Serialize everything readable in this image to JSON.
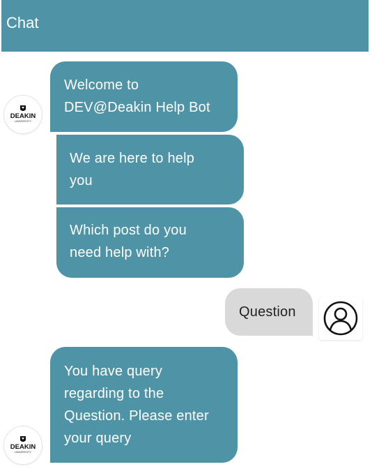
{
  "header": {
    "title": "Chat",
    "color": "#4f93a6"
  },
  "messages": [
    {
      "sender": "bot",
      "lines": [
        "Welcome to",
        "DEV@Deakin Help Bot"
      ]
    },
    {
      "sender": "bot",
      "lines": [
        "We are here to help",
        "you"
      ]
    },
    {
      "sender": "bot",
      "lines": [
        "Which post do you",
        "need help with?"
      ]
    },
    {
      "sender": "user",
      "lines": [
        "Question"
      ]
    },
    {
      "sender": "bot",
      "lines": [
        "You have query",
        "regarding to the",
        "Question. Please enter",
        "your query"
      ]
    }
  ],
  "bot_avatar": {
    "icon": "deakin-logo-icon",
    "name": "DEAKIN",
    "subtitle": "UNIVERSITY"
  },
  "user_avatar": {
    "icon": "user-profile-icon"
  },
  "colors": {
    "bot_bubble": "#4f93a6",
    "user_bubble": "#d9d9d9",
    "bot_text": "#ffffff",
    "user_text": "#222222"
  }
}
